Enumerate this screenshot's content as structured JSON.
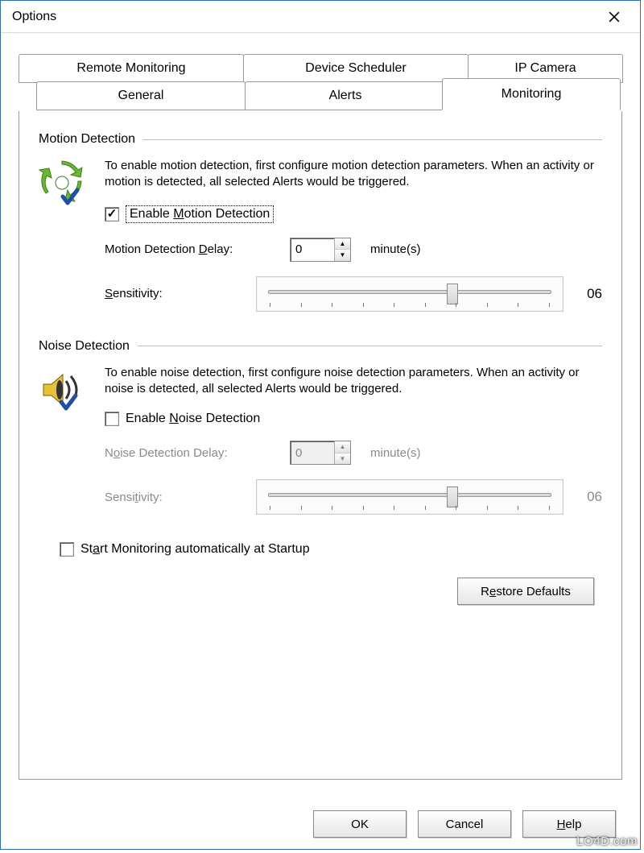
{
  "window": {
    "title": "Options"
  },
  "tabs": {
    "row1": [
      "Remote Monitoring",
      "Device Scheduler",
      "IP Camera"
    ],
    "row2": [
      "General",
      "Alerts",
      "Monitoring"
    ],
    "active": "Monitoring"
  },
  "motion": {
    "title": "Motion Detection",
    "desc": "To enable motion detection, first configure motion detection parameters. When an activity or motion is detected, all selected Alerts would be triggered.",
    "enable_label": "Enable Motion Detection",
    "enable_checked": true,
    "delay_label": "Motion Detection Delay:",
    "delay_value": "0",
    "delay_unit": "minute(s)",
    "sens_label": "Sensitivity:",
    "sens_value": "06",
    "sens_pos_pct": 62
  },
  "noise": {
    "title": "Noise Detection",
    "desc": "To enable noise detection, first configure noise detection parameters. When an activity or noise is detected, all selected Alerts would be triggered.",
    "enable_label": "Enable Noise Detection",
    "enable_checked": false,
    "delay_label": "Noise Detection Delay:",
    "delay_value": "0",
    "delay_unit": "minute(s)",
    "sens_label": "Sensitivity:",
    "sens_value": "06",
    "sens_pos_pct": 62
  },
  "startup": {
    "label": "Start Monitoring automatically at Startup",
    "checked": false
  },
  "buttons": {
    "restore": "Restore Defaults",
    "ok": "OK",
    "cancel": "Cancel",
    "help": "Help"
  },
  "watermark": "LO4D.com"
}
